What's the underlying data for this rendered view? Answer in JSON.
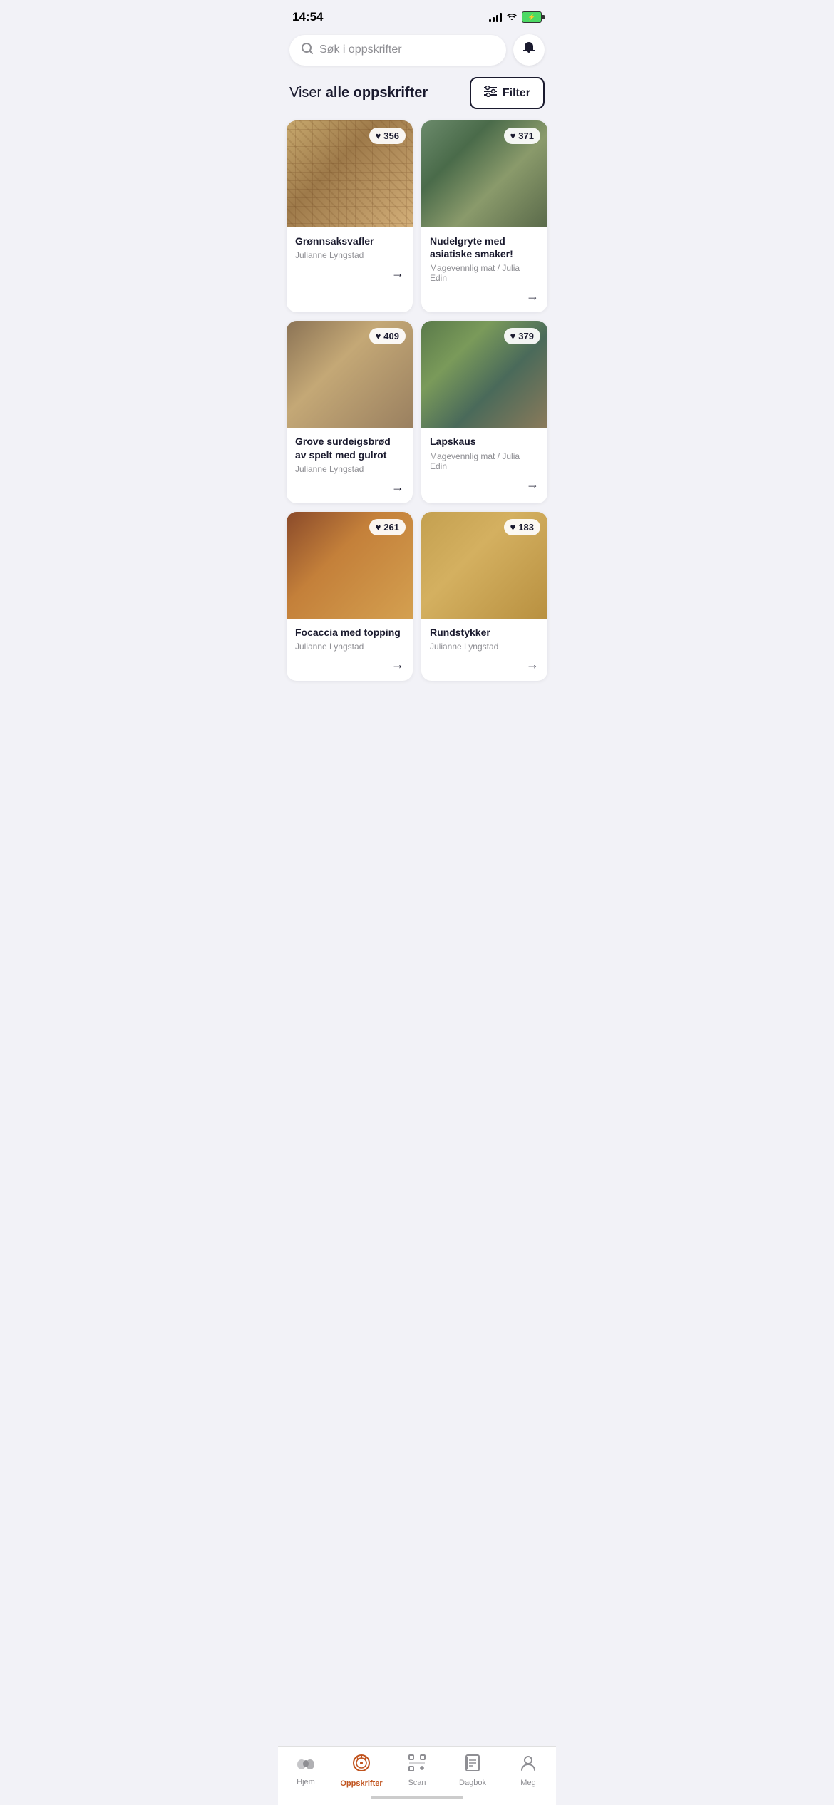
{
  "statusBar": {
    "time": "14:54"
  },
  "search": {
    "placeholder": "Søk i oppskrifter"
  },
  "header": {
    "showing_label": "Viser ",
    "showing_bold": "alle oppskrifter",
    "filter_label": "Filter"
  },
  "recipes": [
    {
      "id": 1,
      "title": "Grønnsaksvafler",
      "author": "Julianne Lyngstad",
      "likes": "356",
      "imgClass": "img-waffles"
    },
    {
      "id": 2,
      "title": "Nudelgryte med asiatiske smaker!",
      "author": "Magevennlig mat / Julia Edin",
      "likes": "371",
      "imgClass": "img-noodles"
    },
    {
      "id": 3,
      "title": "Grove surdeigsbrød av spelt med gulrot",
      "author": "Julianne Lyngstad",
      "likes": "409",
      "imgClass": "img-bread"
    },
    {
      "id": 4,
      "title": "Lapskaus",
      "author": "Magevennlig mat / Julia Edin",
      "likes": "379",
      "imgClass": "img-lapskaus"
    },
    {
      "id": 5,
      "title": "Focaccia med topping",
      "author": "Julianne Lyngstad",
      "likes": "261",
      "imgClass": "img-pizza"
    },
    {
      "id": 6,
      "title": "Rundstykker",
      "author": "Julianne Lyngstad",
      "likes": "183",
      "imgClass": "img-bread2"
    }
  ],
  "nav": {
    "items": [
      {
        "id": "hjem",
        "label": "Hjem",
        "icon": "🥔",
        "active": false
      },
      {
        "id": "oppskrifter",
        "label": "Oppskrifter",
        "icon": "🍳",
        "active": true
      },
      {
        "id": "scan",
        "label": "Scan",
        "icon": "scan",
        "active": false
      },
      {
        "id": "dagbok",
        "label": "Dagbok",
        "icon": "📓",
        "active": false
      },
      {
        "id": "meg",
        "label": "Meg",
        "icon": "👤",
        "active": false
      }
    ]
  }
}
